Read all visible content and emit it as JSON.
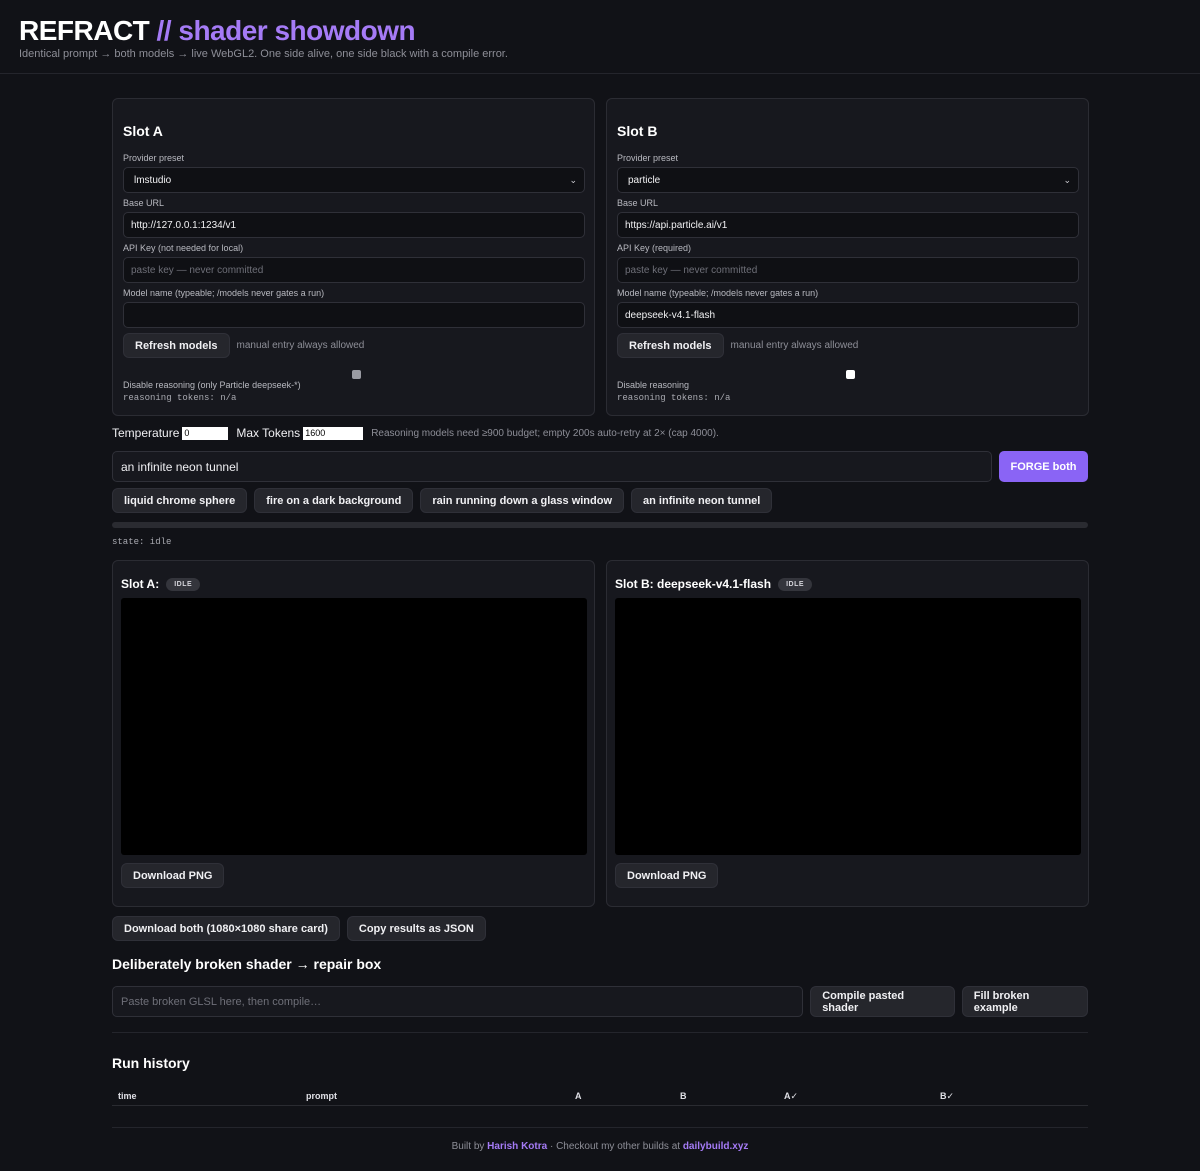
{
  "header": {
    "title_main": "REFRACT",
    "title_accent": "// shader showdown",
    "subtitle": "Identical prompt → both models → live WebGL2. One side alive, one side black with a compile error."
  },
  "slots": [
    {
      "title": "Slot A",
      "provider_label": "Provider preset",
      "provider_value": "lmstudio",
      "base_url_label": "Base URL",
      "base_url_value": "http://127.0.0.1:1234/v1",
      "api_key_label": "API Key (not needed for local)",
      "api_key_placeholder": "paste key — never committed",
      "model_label": "Model name (typeable; /models never gates a run)",
      "model_value": "",
      "refresh_label": "Refresh models",
      "manual_hint": "manual entry always allowed",
      "reasoning_label": "Disable reasoning (only Particle deepseek-*)",
      "reasoning_checked": false,
      "reasoning_tokens": "reasoning tokens: n/a"
    },
    {
      "title": "Slot B",
      "provider_label": "Provider preset",
      "provider_value": "particle",
      "base_url_label": "Base URL",
      "base_url_value": "https://api.particle.ai/v1",
      "api_key_label": "API Key (required)",
      "api_key_placeholder": "paste key — never committed",
      "model_label": "Model name (typeable; /models never gates a run)",
      "model_value": "deepseek-v4.1-flash",
      "refresh_label": "Refresh models",
      "manual_hint": "manual entry always allowed",
      "reasoning_label": "Disable reasoning",
      "reasoning_checked": true,
      "reasoning_tokens": "reasoning tokens: n/a"
    }
  ],
  "params": {
    "temperature_label": "Temperature",
    "temperature_value": "0",
    "max_tokens_label": "Max Tokens",
    "max_tokens_value": "1600",
    "note": "Reasoning models need ≥900 budget; empty 200s auto-retry at 2× (cap 4000)."
  },
  "prompt": {
    "value": "an infinite neon tunnel",
    "forge_label": "FORGE both",
    "presets": [
      "liquid chrome sphere",
      "fire on a dark background",
      "rain running down a glass window",
      "an infinite neon tunnel"
    ]
  },
  "progress": 0,
  "state": "state: idle",
  "outputs": [
    {
      "title": "Slot A:",
      "badge": "IDLE",
      "download_label": "Download PNG"
    },
    {
      "title": "Slot B: deepseek-v4.1-flash",
      "badge": "IDLE",
      "download_label": "Download PNG"
    }
  ],
  "share": {
    "download_both": "Download both (1080×1080 share card)",
    "copy_json": "Copy results as JSON"
  },
  "repair": {
    "title": "Deliberately broken shader → repair box",
    "placeholder": "Paste broken GLSL here, then compile…",
    "compile_label": "Compile pasted shader",
    "fill_label": "Fill broken example"
  },
  "history": {
    "title": "Run history",
    "columns": [
      "time",
      "prompt",
      "A",
      "B",
      "A✓",
      "B✓"
    ],
    "rows": []
  },
  "footer": {
    "prefix": "Built by",
    "author": "Harish Kotra",
    "middle": "· Checkout my other builds at",
    "site": "dailybuild.xyz"
  },
  "colors": {
    "accent": "#a57bf6",
    "forge": "#8a64f5",
    "background": "#111217"
  }
}
